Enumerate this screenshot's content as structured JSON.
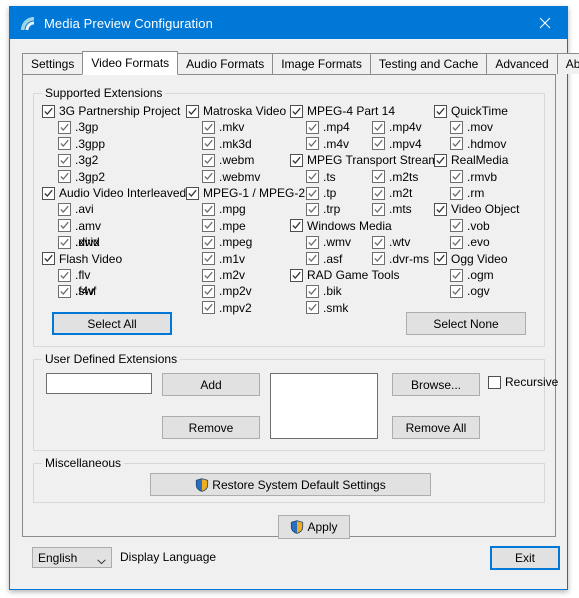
{
  "window": {
    "title": "Media Preview Configuration",
    "icon": "app-icon",
    "close_icon": "close-icon",
    "accent": "#0078d7"
  },
  "tabs": [
    {
      "label": "Settings",
      "active": false
    },
    {
      "label": "Video Formats",
      "active": true
    },
    {
      "label": "Audio Formats",
      "active": false
    },
    {
      "label": "Image Formats",
      "active": false
    },
    {
      "label": "Testing and Cache",
      "active": false
    },
    {
      "label": "Advanced",
      "active": false
    },
    {
      "label": "About...",
      "active": false
    }
  ],
  "supported": {
    "legend": "Supported Extensions",
    "columns": [
      {
        "groups": [
          {
            "label": "3G Partnership Project",
            "checked": true,
            "items": [
              [
                ".3gp"
              ],
              [
                ".3gpp"
              ],
              [
                ".3g2"
              ],
              [
                ".3gp2"
              ]
            ]
          },
          {
            "label": "Audio Video Interleaved",
            "checked": true,
            "items": [
              [
                ".avi"
              ],
              [
                ".amv"
              ],
              [
                ".divx",
                ".xvid"
              ]
            ]
          },
          {
            "label": "Flash Video",
            "checked": true,
            "items": [
              [
                ".flv"
              ],
              [
                ".f4v",
                ".swf"
              ]
            ]
          }
        ]
      },
      {
        "groups": [
          {
            "label": "Matroska Video",
            "checked": true,
            "items": [
              [
                ".mkv"
              ],
              [
                ".mk3d"
              ],
              [
                ".webm"
              ],
              [
                ".webmv"
              ]
            ]
          },
          {
            "label": "MPEG-1 / MPEG-2",
            "checked": true,
            "items": [
              [
                ".mpg"
              ],
              [
                ".mpe"
              ],
              [
                ".mpeg"
              ],
              [
                ".m1v"
              ],
              [
                ".m2v"
              ],
              [
                ".mp2v"
              ],
              [
                ".mpv2"
              ]
            ]
          }
        ]
      },
      {
        "groups": [
          {
            "label": "MPEG-4 Part 14",
            "checked": true,
            "items": [
              [
                ".mp4",
                ".mp4v"
              ],
              [
                ".m4v",
                ".mpv4"
              ]
            ]
          },
          {
            "label": "MPEG Transport Stream",
            "checked": true,
            "items": [
              [
                ".ts",
                ".m2ts"
              ],
              [
                ".tp",
                ".m2t"
              ],
              [
                ".trp",
                ".mts"
              ]
            ]
          },
          {
            "label": "Windows Media",
            "checked": true,
            "items": [
              [
                ".wmv",
                ".wtv"
              ],
              [
                ".asf",
                ".dvr-ms"
              ]
            ]
          },
          {
            "label": "RAD Game Tools",
            "checked": true,
            "items": [
              [
                ".bik"
              ],
              [
                ".smk"
              ]
            ]
          }
        ]
      },
      {
        "groups": [
          {
            "label": "QuickTime",
            "checked": true,
            "items": [
              [
                ".mov"
              ],
              [
                ".hdmov"
              ]
            ]
          },
          {
            "label": "RealMedia",
            "checked": true,
            "items": [
              [
                ".rmvb"
              ],
              [
                ".rm"
              ]
            ]
          },
          {
            "label": "Video Object",
            "checked": true,
            "items": [
              [
                ".vob"
              ],
              [
                ".evo"
              ]
            ]
          },
          {
            "label": "Ogg Video",
            "checked": true,
            "items": [
              [
                ".ogm"
              ],
              [
                ".ogv"
              ]
            ]
          }
        ]
      }
    ],
    "select_all": "Select All",
    "select_none": "Select None"
  },
  "user_defined": {
    "legend": "User Defined Extensions",
    "input_value": "",
    "input_placeholder": "",
    "list_value": "",
    "add": "Add",
    "remove": "Remove",
    "browse": "Browse...",
    "remove_all": "Remove All",
    "recursive": "Recursive",
    "recursive_checked": false
  },
  "misc": {
    "legend": "Miscellaneous",
    "restore": "Restore System Default Settings",
    "apply": "Apply"
  },
  "bottom": {
    "language": "English",
    "language_label": "Display Language",
    "exit": "Exit"
  }
}
